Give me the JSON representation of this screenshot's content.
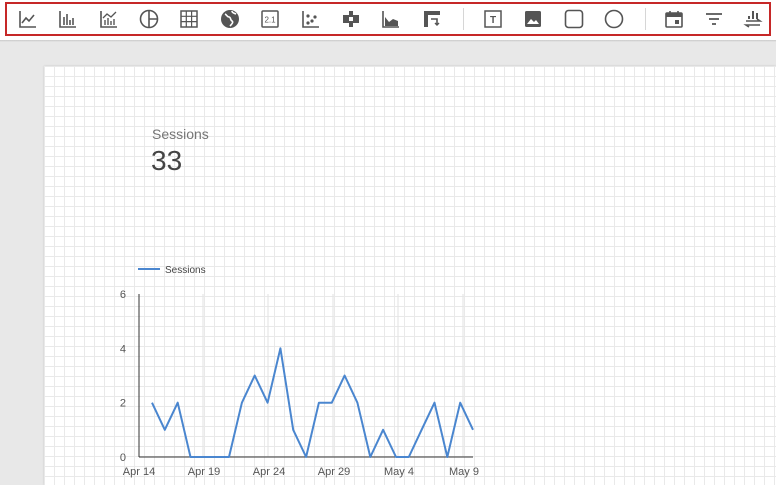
{
  "toolbar": {
    "icons": [
      "time-series-chart-icon",
      "bar-chart-icon",
      "combo-chart-icon",
      "pie-chart-icon",
      "table-icon",
      "geo-map-icon",
      "scorecard-icon",
      "scatter-chart-icon",
      "bullet-chart-icon",
      "area-chart-icon",
      "pivot-table-icon",
      "text-icon",
      "image-icon",
      "rectangle-icon",
      "circle-icon",
      "date-range-icon",
      "filter-control-icon",
      "data-control-icon"
    ],
    "scorecard_icon_text": "2.1",
    "text_icon_text": "T",
    "accent_color": "#c62828"
  },
  "scorecard": {
    "label": "Sessions",
    "value": "33"
  },
  "chart_data": {
    "type": "line",
    "legend": "Sessions",
    "series_color": "#4a86cf",
    "x_ticks": [
      "Apr 14",
      "Apr 19",
      "Apr 24",
      "Apr 29",
      "May 4",
      "May 9"
    ],
    "y_ticks": [
      "0",
      "2",
      "4",
      "6"
    ],
    "ylim": [
      0,
      6
    ],
    "x": [
      "Apr 15",
      "Apr 16",
      "Apr 17",
      "Apr 18",
      "Apr 19",
      "Apr 20",
      "Apr 21",
      "Apr 22",
      "Apr 23",
      "Apr 24",
      "Apr 25",
      "Apr 26",
      "Apr 27",
      "Apr 28",
      "Apr 29",
      "Apr 30",
      "May 1",
      "May 2",
      "May 3",
      "May 4",
      "May 5",
      "May 6",
      "May 7",
      "May 8",
      "May 9",
      "May 10"
    ],
    "series": [
      {
        "name": "Sessions",
        "values": [
          2,
          1,
          2,
          0,
          0,
          0,
          0,
          2,
          3,
          2,
          4,
          1,
          0,
          2,
          2,
          3,
          2,
          0,
          1,
          0,
          0,
          1,
          2,
          0,
          2,
          1
        ]
      }
    ]
  }
}
